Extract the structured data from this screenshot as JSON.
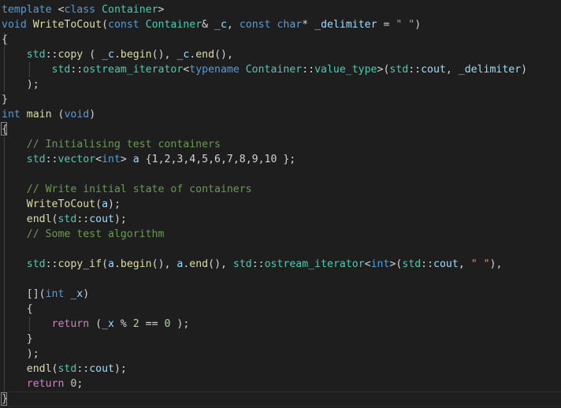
{
  "editor": {
    "language": "cpp",
    "colors": {
      "background": "#1e1e1e",
      "keyword": "#569cd6",
      "type": "#4ec9b0",
      "function": "#dcdcaa",
      "variable": "#9cdcfe",
      "string": "#ce9178",
      "number": "#b5cea8",
      "comment": "#6a9955",
      "control": "#c586c0",
      "punctuation": "#d4d4d4"
    },
    "lines": [
      [
        [
          "kw",
          "template"
        ],
        [
          "pun",
          " <"
        ],
        [
          "kw",
          "class"
        ],
        [
          "pun",
          " "
        ],
        [
          "type",
          "Container"
        ],
        [
          "pun",
          ">"
        ]
      ],
      [
        [
          "kw",
          "void"
        ],
        [
          "pun",
          " "
        ],
        [
          "fn",
          "WriteToCout"
        ],
        [
          "pun",
          "("
        ],
        [
          "kw",
          "const"
        ],
        [
          "pun",
          " "
        ],
        [
          "type",
          "Container"
        ],
        [
          "pun",
          "& "
        ],
        [
          "var",
          "_c"
        ],
        [
          "pun",
          ", "
        ],
        [
          "kw",
          "const"
        ],
        [
          "pun",
          " "
        ],
        [
          "kw",
          "char"
        ],
        [
          "pun",
          "* "
        ],
        [
          "var",
          "_delimiter"
        ],
        [
          "pun",
          " = "
        ],
        [
          "str",
          "\" \""
        ],
        [
          "pun",
          ")"
        ]
      ],
      [
        [
          "pun",
          "{"
        ]
      ],
      [
        [
          "pun",
          "    "
        ],
        [
          "type",
          "std"
        ],
        [
          "pun",
          "::"
        ],
        [
          "fn",
          "copy"
        ],
        [
          "pun",
          " ( "
        ],
        [
          "var",
          "_c"
        ],
        [
          "pun",
          "."
        ],
        [
          "fn",
          "begin"
        ],
        [
          "pun",
          "(), "
        ],
        [
          "var",
          "_c"
        ],
        [
          "pun",
          "."
        ],
        [
          "fn",
          "end"
        ],
        [
          "pun",
          "(),"
        ]
      ],
      [
        [
          "pun",
          "        "
        ],
        [
          "type",
          "std"
        ],
        [
          "pun",
          "::"
        ],
        [
          "type",
          "ostream_iterator"
        ],
        [
          "pun",
          "<"
        ],
        [
          "kw",
          "typename"
        ],
        [
          "pun",
          " "
        ],
        [
          "type",
          "Container"
        ],
        [
          "pun",
          "::"
        ],
        [
          "type",
          "value_type"
        ],
        [
          "pun",
          ">("
        ],
        [
          "type",
          "std"
        ],
        [
          "pun",
          "::"
        ],
        [
          "var",
          "cout"
        ],
        [
          "pun",
          ", "
        ],
        [
          "var",
          "_delimiter"
        ],
        [
          "pun",
          ")"
        ]
      ],
      [
        [
          "pun",
          "    );"
        ]
      ],
      [
        [
          "pun",
          "}"
        ]
      ],
      [
        [
          "kw",
          "int"
        ],
        [
          "pun",
          " "
        ],
        [
          "fn",
          "main"
        ],
        [
          "pun",
          " ("
        ],
        [
          "kw",
          "void"
        ],
        [
          "pun",
          ")"
        ]
      ],
      [
        [
          "pun",
          "{"
        ]
      ],
      [
        [
          "pun",
          "    "
        ],
        [
          "cm",
          "// Initialising test containers"
        ]
      ],
      [
        [
          "pun",
          "    "
        ],
        [
          "type",
          "std"
        ],
        [
          "pun",
          "::"
        ],
        [
          "type",
          "vector"
        ],
        [
          "pun",
          "<"
        ],
        [
          "kw",
          "int"
        ],
        [
          "pun",
          "> "
        ],
        [
          "var",
          "a"
        ],
        [
          "pun",
          " {1,2,3,4,5,6,7,8,9,10 };"
        ]
      ],
      [
        [
          "pun",
          ""
        ]
      ],
      [
        [
          "pun",
          "    "
        ],
        [
          "cm",
          "// Write initial state of containers"
        ]
      ],
      [
        [
          "pun",
          "    "
        ],
        [
          "fn",
          "WriteToCout"
        ],
        [
          "pun",
          "("
        ],
        [
          "var",
          "a"
        ],
        [
          "pun",
          ");"
        ]
      ],
      [
        [
          "pun",
          "    "
        ],
        [
          "fn",
          "endl"
        ],
        [
          "pun",
          "("
        ],
        [
          "type",
          "std"
        ],
        [
          "pun",
          "::"
        ],
        [
          "var",
          "cout"
        ],
        [
          "pun",
          ");"
        ]
      ],
      [
        [
          "pun",
          "    "
        ],
        [
          "cm",
          "// Some test algorithm"
        ]
      ],
      [
        [
          "pun",
          ""
        ]
      ],
      [
        [
          "pun",
          "    "
        ],
        [
          "type",
          "std"
        ],
        [
          "pun",
          "::"
        ],
        [
          "fn",
          "copy_if"
        ],
        [
          "pun",
          "("
        ],
        [
          "var",
          "a"
        ],
        [
          "pun",
          "."
        ],
        [
          "fn",
          "begin"
        ],
        [
          "pun",
          "(), "
        ],
        [
          "var",
          "a"
        ],
        [
          "pun",
          "."
        ],
        [
          "fn",
          "end"
        ],
        [
          "pun",
          "(), "
        ],
        [
          "type",
          "std"
        ],
        [
          "pun",
          "::"
        ],
        [
          "type",
          "ostream_iterator"
        ],
        [
          "pun",
          "<"
        ],
        [
          "kw",
          "int"
        ],
        [
          "pun",
          ">("
        ],
        [
          "type",
          "std"
        ],
        [
          "pun",
          "::"
        ],
        [
          "var",
          "cout"
        ],
        [
          "pun",
          ", "
        ],
        [
          "str",
          "\" \""
        ],
        [
          "pun",
          "),"
        ]
      ],
      [
        [
          "pun",
          ""
        ]
      ],
      [
        [
          "pun",
          "    []("
        ],
        [
          "kw",
          "int"
        ],
        [
          "pun",
          " "
        ],
        [
          "var",
          "_x"
        ],
        [
          "pun",
          ")"
        ]
      ],
      [
        [
          "pun",
          "    {"
        ]
      ],
      [
        [
          "pun",
          "        "
        ],
        [
          "ctl",
          "return"
        ],
        [
          "pun",
          " ("
        ],
        [
          "var",
          "_x"
        ],
        [
          "pun",
          " % "
        ],
        [
          "num",
          "2"
        ],
        [
          "pun",
          " == "
        ],
        [
          "num",
          "0"
        ],
        [
          "pun",
          " );"
        ]
      ],
      [
        [
          "pun",
          "    }"
        ]
      ],
      [
        [
          "pun",
          "    );"
        ]
      ],
      [
        [
          "pun",
          "    "
        ],
        [
          "fn",
          "endl"
        ],
        [
          "pun",
          "("
        ],
        [
          "type",
          "std"
        ],
        [
          "pun",
          "::"
        ],
        [
          "var",
          "cout"
        ],
        [
          "pun",
          ");"
        ]
      ],
      [
        [
          "pun",
          "    "
        ],
        [
          "ctl",
          "return"
        ],
        [
          "pun",
          " "
        ],
        [
          "num",
          "0"
        ],
        [
          "pun",
          ";"
        ]
      ],
      [
        [
          "pun",
          "}"
        ]
      ]
    ]
  }
}
